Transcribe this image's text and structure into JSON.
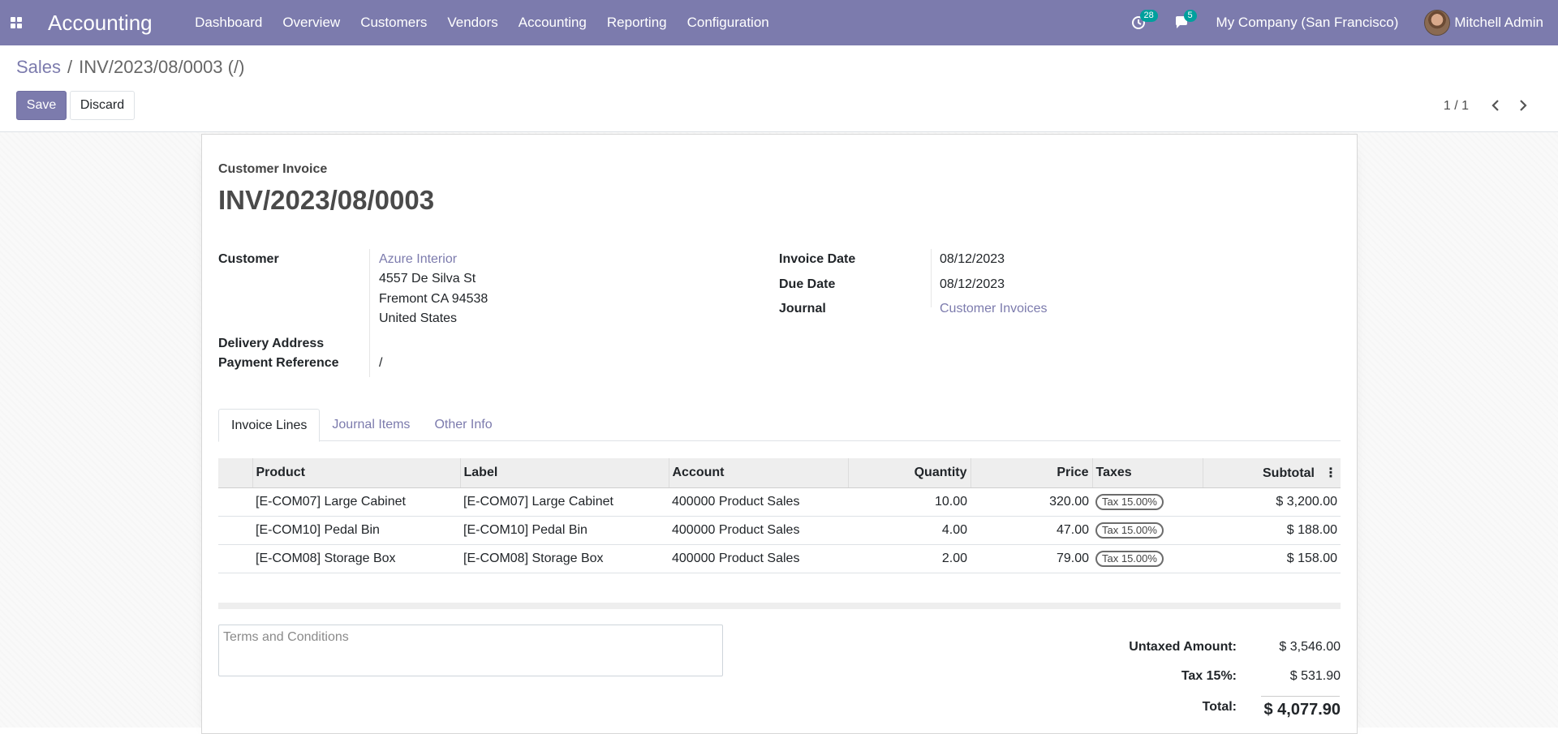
{
  "navbar": {
    "app_name": "Accounting",
    "menu": [
      "Dashboard",
      "Overview",
      "Customers",
      "Vendors",
      "Accounting",
      "Reporting",
      "Configuration"
    ],
    "activity_count": "28",
    "message_count": "5",
    "company": "My Company (San Francisco)",
    "user": "Mitchell Admin"
  },
  "control": {
    "breadcrumb_parent": "Sales",
    "breadcrumb_separator": "/",
    "breadcrumb_current": "INV/2023/08/0003 (/)",
    "save_label": "Save",
    "discard_label": "Discard",
    "pager": "1 / 1"
  },
  "form": {
    "doc_type": "Customer Invoice",
    "title": "INV/2023/08/0003",
    "customer_label": "Customer",
    "customer_name": "Azure Interior",
    "address_line1": "4557 De Silva St",
    "address_line2": "Fremont CA 94538",
    "address_line3": "United States",
    "delivery_label": "Delivery Address",
    "payment_ref_label": "Payment Reference",
    "payment_ref_value": "/",
    "invoice_date_label": "Invoice Date",
    "invoice_date": "08/12/2023",
    "due_date_label": "Due Date",
    "due_date": "08/12/2023",
    "journal_label": "Journal",
    "journal": "Customer Invoices"
  },
  "tabs": [
    "Invoice Lines",
    "Journal Items",
    "Other Info"
  ],
  "table": {
    "headers": [
      "Product",
      "Label",
      "Account",
      "Quantity",
      "Price",
      "Taxes",
      "Subtotal"
    ],
    "rows": [
      {
        "product": "[E-COM07] Large Cabinet",
        "label": "[E-COM07] Large Cabinet",
        "account": "400000 Product Sales",
        "quantity": "10.00",
        "price": "320.00",
        "tax": "Tax 15.00%",
        "subtotal": "$ 3,200.00"
      },
      {
        "product": "[E-COM10] Pedal Bin",
        "label": "[E-COM10] Pedal Bin",
        "account": "400000 Product Sales",
        "quantity": "4.00",
        "price": "47.00",
        "tax": "Tax 15.00%",
        "subtotal": "$ 188.00"
      },
      {
        "product": "[E-COM08] Storage Box",
        "label": "[E-COM08] Storage Box",
        "account": "400000 Product Sales",
        "quantity": "2.00",
        "price": "79.00",
        "tax": "Tax 15.00%",
        "subtotal": "$ 158.00"
      }
    ]
  },
  "terms_placeholder": "Terms and Conditions",
  "totals": {
    "untaxed_label": "Untaxed Amount:",
    "untaxed_value": "$ 3,546.00",
    "tax_label": "Tax 15%:",
    "tax_value": "$ 531.90",
    "total_label": "Total:",
    "total_value": "$ 4,077.90"
  },
  "colors": {
    "brand": "#7c7bad",
    "badge": "#00a09d"
  }
}
